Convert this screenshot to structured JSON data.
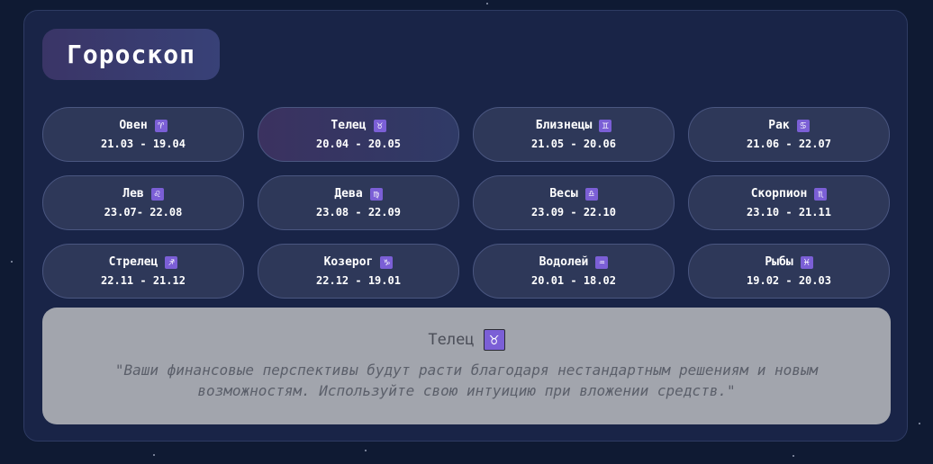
{
  "header": {
    "title": "Гороскоп"
  },
  "signs": [
    {
      "name": "Овен",
      "symbol": "♈",
      "dates": "21.03 - 19.04"
    },
    {
      "name": "Телец",
      "symbol": "♉",
      "dates": "20.04 - 20.05"
    },
    {
      "name": "Близнецы",
      "symbol": "♊",
      "dates": "21.05 - 20.06"
    },
    {
      "name": "Рак",
      "symbol": "♋",
      "dates": "21.06 - 22.07"
    },
    {
      "name": "Лев",
      "symbol": "♌",
      "dates": "23.07- 22.08"
    },
    {
      "name": "Дева",
      "symbol": "♍",
      "dates": "23.08 - 22.09"
    },
    {
      "name": "Весы",
      "symbol": "♎",
      "dates": "23.09 - 22.10"
    },
    {
      "name": "Скорпион",
      "symbol": "♏",
      "dates": "23.10 - 21.11"
    },
    {
      "name": "Стрелец",
      "symbol": "♐",
      "dates": "22.11 - 21.12"
    },
    {
      "name": "Козерог",
      "symbol": "♑",
      "dates": "22.12 - 19.01"
    },
    {
      "name": "Водолей",
      "symbol": "♒",
      "dates": "20.01 - 18.02"
    },
    {
      "name": "Рыбы",
      "symbol": "♓",
      "dates": "19.02 - 20.03"
    }
  ],
  "reading": {
    "sign_name": "Телец",
    "symbol": "♉",
    "text": "\"Ваши финансовые перспективы будут расти благодаря нестандартным решениям и новым возможностям. Используйте свою интуицию при вложении средств.\""
  }
}
